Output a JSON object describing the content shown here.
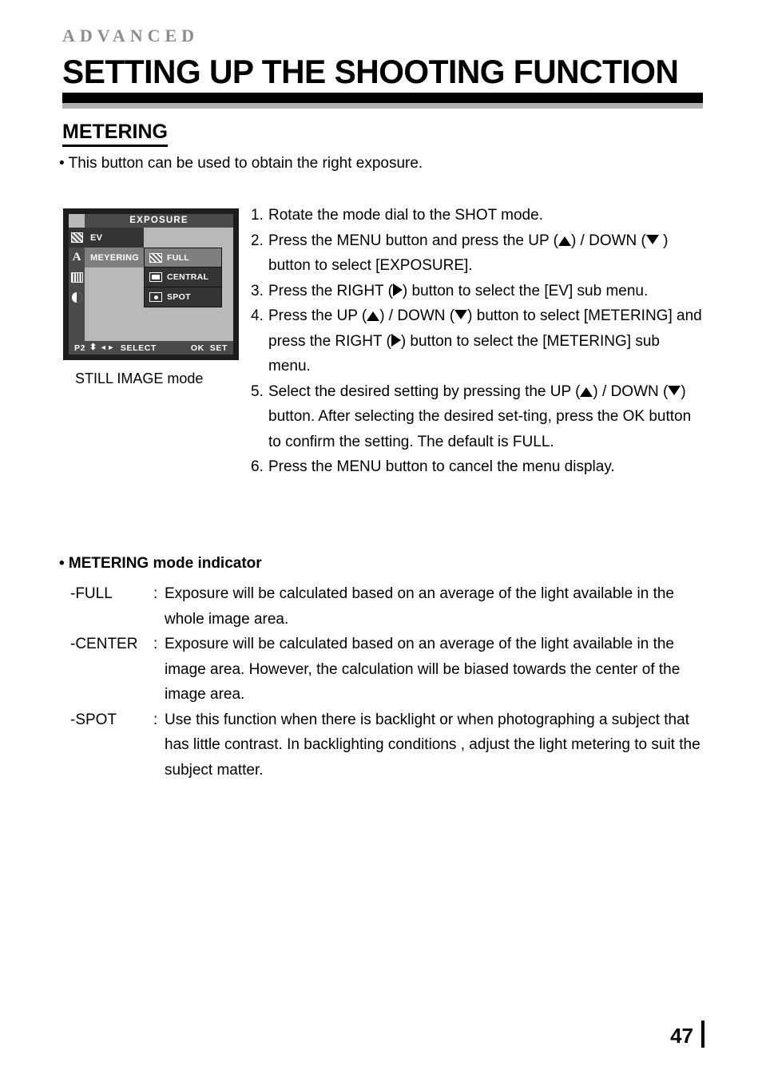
{
  "header": {
    "kicker": "ADVANCED",
    "title": "SETTING UP THE SHOOTING FUNCTION"
  },
  "section": {
    "heading": "METERING",
    "intro": "• This button can be used to obtain the right exposure."
  },
  "lcd": {
    "title": "EXPOSURE",
    "caption": "STILL IMAGE mode",
    "rail_icons": [
      "hatch-square-icon",
      "letter-a-icon",
      "vertical-bars-icon",
      "contrast-circle-icon",
      "blank-icon"
    ],
    "menu": [
      {
        "label": "EV",
        "state": "dark"
      },
      {
        "label": "MEYERING",
        "state": "mid"
      }
    ],
    "submenu": [
      {
        "label": "FULL",
        "icon": "hatch-square-icon",
        "state": "mid"
      },
      {
        "label": "CENTRAL",
        "icon": "central-rect-icon",
        "state": "dark"
      },
      {
        "label": "SPOT",
        "icon": "spot-dot-icon",
        "state": "dark"
      }
    ],
    "status": {
      "page": "P2",
      "updown_glyph": "⬍",
      "leftright_glyph": "◄►",
      "select": "SELECT",
      "ok": "OK",
      "set": "SET"
    }
  },
  "steps": [
    {
      "num": "1.",
      "parts": [
        {
          "t": "text",
          "v": "Rotate the mode dial to the SHOT mode."
        }
      ]
    },
    {
      "num": "2.",
      "parts": [
        {
          "t": "text",
          "v": "Press the MENU button and press the UP ("
        },
        {
          "t": "tri",
          "v": "up"
        },
        {
          "t": "text",
          "v": ") / DOWN ("
        },
        {
          "t": "tri",
          "v": "dn"
        },
        {
          "t": "text",
          "v": " ) button to select [EXPOSURE]."
        }
      ]
    },
    {
      "num": "3.",
      "parts": [
        {
          "t": "text",
          "v": "Press the RIGHT ("
        },
        {
          "t": "tri",
          "v": "rt"
        },
        {
          "t": "text",
          "v": ") button to select the [EV] sub menu."
        }
      ]
    },
    {
      "num": "4.",
      "parts": [
        {
          "t": "text",
          "v": "Press the UP ("
        },
        {
          "t": "tri",
          "v": "up"
        },
        {
          "t": "text",
          "v": ") / DOWN ("
        },
        {
          "t": "tri",
          "v": "dn"
        },
        {
          "t": "text",
          "v": ") button to select [METERING] and press the RIGHT ("
        },
        {
          "t": "tri",
          "v": "rt"
        },
        {
          "t": "text",
          "v": ") button to  select the  [METERING] sub menu."
        }
      ]
    },
    {
      "num": "5.",
      "parts": [
        {
          "t": "text",
          "v": "Select the desired setting by pressing the UP ("
        },
        {
          "t": "tri",
          "v": "up"
        },
        {
          "t": "text",
          "v": ") / DOWN ("
        },
        {
          "t": "tri",
          "v": "dn"
        },
        {
          "t": "text",
          "v": ") button. After selecting the desired set-ting, press the OK button to confirm the setting. The default is FULL."
        }
      ]
    },
    {
      "num": "6.",
      "parts": [
        {
          "t": "text",
          "v": "Press the MENU button to cancel the menu display."
        }
      ]
    }
  ],
  "indicator": {
    "heading": "• METERING mode indicator",
    "rows": [
      {
        "term": "-FULL",
        "colon": ":",
        "definition": "Exposure will be calculated based on an average of the light available in the whole image area."
      },
      {
        "term": "-CENTER",
        "colon": ":",
        "definition": "Exposure will be calculated based on an average of the light available in the  image area. However, the calculation will be biased towards the center of the image area."
      },
      {
        "term": "-SPOT",
        "colon": ":",
        "definition": "Use this function when there is backlight or when photographing a subject that has little contrast. In backlighting conditions , adjust the light metering to suit the subject matter."
      }
    ]
  },
  "footer": {
    "page_number": "47"
  },
  "colors": {
    "rule_black": "#000000",
    "rule_gray": "#b0b0b0",
    "kicker_gray": "#8d8d8d",
    "lcd_bezel": "#1c1c1c",
    "lcd_bg": "#b9b9b9",
    "lcd_bar": "#4a4a4a",
    "lcd_row_dark": "#343434",
    "lcd_row_mid": "#7e7e7e"
  }
}
